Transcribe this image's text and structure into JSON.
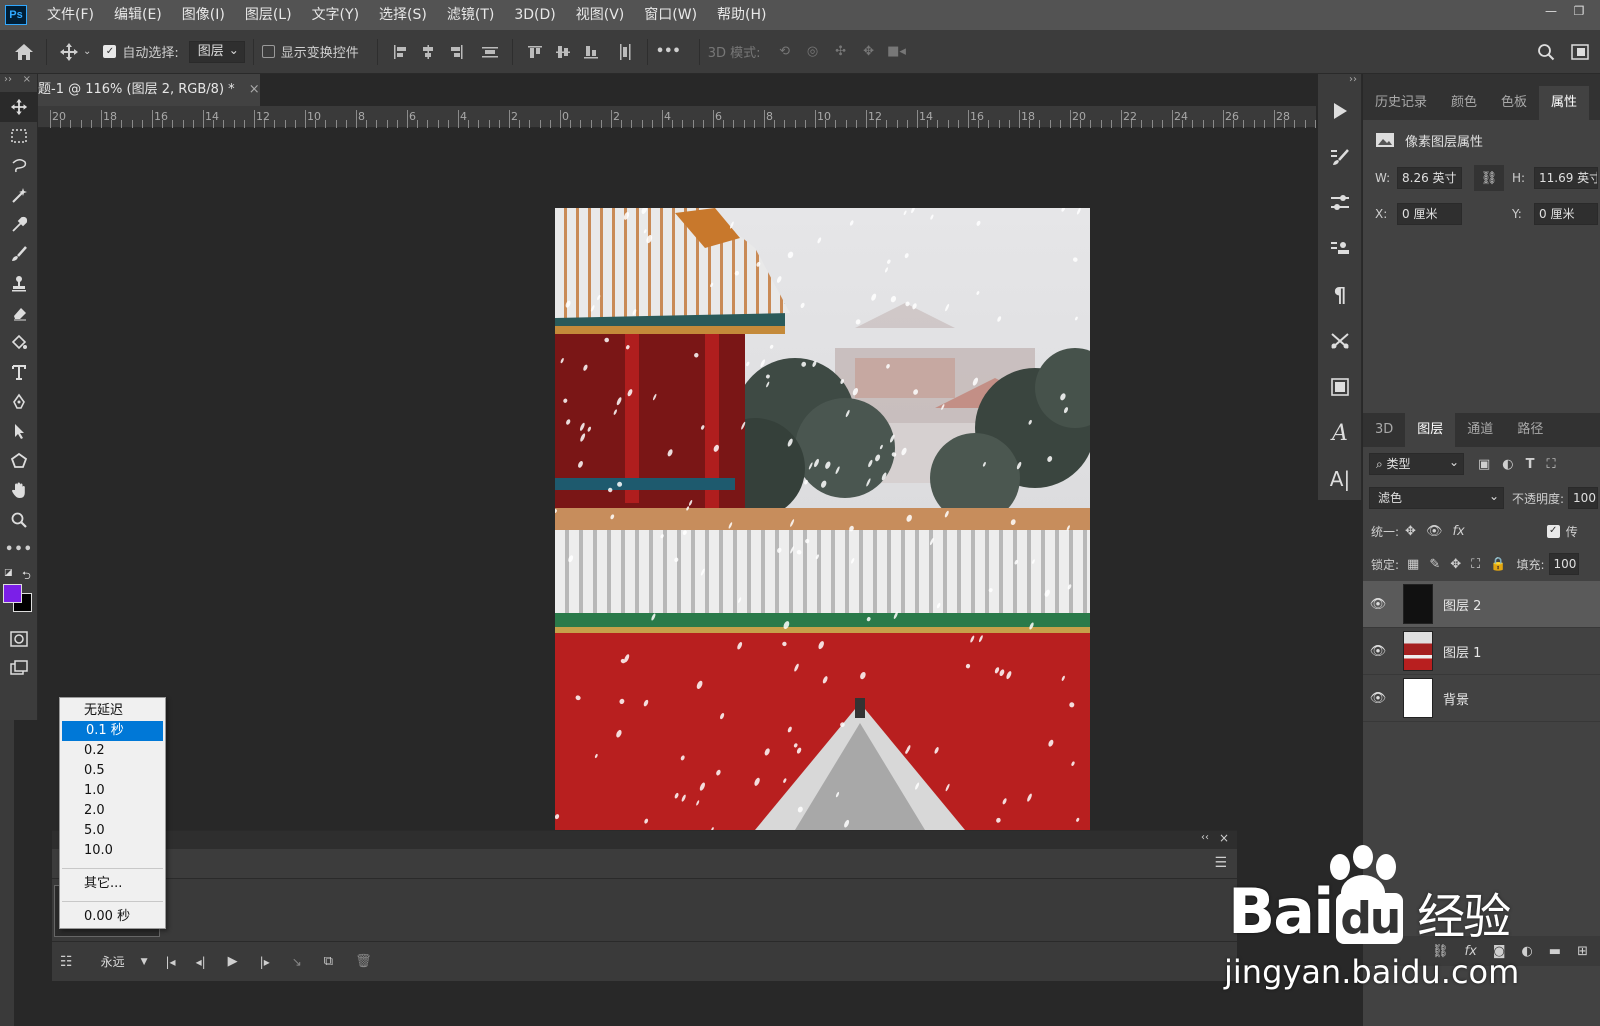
{
  "menubar": {
    "logo": "Ps",
    "items": [
      "文件(F)",
      "编辑(E)",
      "图像(I)",
      "图层(L)",
      "文字(Y)",
      "选择(S)",
      "滤镜(T)",
      "3D(D)",
      "视图(V)",
      "窗口(W)",
      "帮助(H)"
    ]
  },
  "optionsbar": {
    "auto_select_label": "自动选择:",
    "auto_select_value": "图层",
    "show_transform_label": "显示变换控件",
    "mode_3d_label": "3D 模式:",
    "more_label": "•••"
  },
  "document": {
    "tab_title": "题-1 @ 116% (图层 2, RGB/8) *",
    "close_glyph": "×"
  },
  "ruler": {
    "labels": [
      "20",
      "18",
      "16",
      "14",
      "12",
      "10",
      "8",
      "6",
      "4",
      "2",
      "0",
      "2",
      "4",
      "6",
      "8",
      "10",
      "12",
      "14",
      "16",
      "18",
      "20",
      "22",
      "24",
      "26",
      "28"
    ]
  },
  "colors": {
    "foreground": "#7b1fe8",
    "background": "#000000",
    "accent": "#0078d7"
  },
  "properties_panel": {
    "tabs": [
      "历史记录",
      "颜色",
      "色板",
      "属性"
    ],
    "active_tab": "属性",
    "header": "像素图层属性",
    "w_label": "W:",
    "w_value": "8.26 英寸",
    "h_label": "H:",
    "h_value": "11.69 英寸",
    "x_label": "X:",
    "x_value": "0 厘米",
    "y_label": "Y:",
    "y_value": "0 厘米"
  },
  "layers_panel": {
    "tabs": [
      "3D",
      "图层",
      "通道",
      "路径"
    ],
    "active_tab": "图层",
    "filter_label": "类型",
    "blend_mode": "滤色",
    "opacity_label": "不透明度:",
    "opacity_value": "100",
    "unify_label": "统一:",
    "propagate_label": "传",
    "lock_label": "锁定:",
    "fill_label": "填充:",
    "fill_value": "100",
    "layers": [
      {
        "name": "图层 2",
        "selected": true,
        "thumb": "dark"
      },
      {
        "name": "图层 1",
        "selected": false,
        "thumb": "photo"
      },
      {
        "name": "背景",
        "selected": false,
        "thumb": "white"
      }
    ]
  },
  "timeline": {
    "delay_value": "0 秒",
    "loop_value": "永远"
  },
  "delay_dropdown": {
    "items": [
      "无延迟",
      "0.1 秒",
      "0.2",
      "0.5",
      "1.0",
      "2.0",
      "5.0",
      "10.0"
    ],
    "selected": "0.1 秒",
    "other": "其它...",
    "current": "0.00 秒"
  },
  "watermark": {
    "brand": "Bai",
    "brand2": "du",
    "cn": "经验",
    "url": "jingyan.baidu.com"
  }
}
